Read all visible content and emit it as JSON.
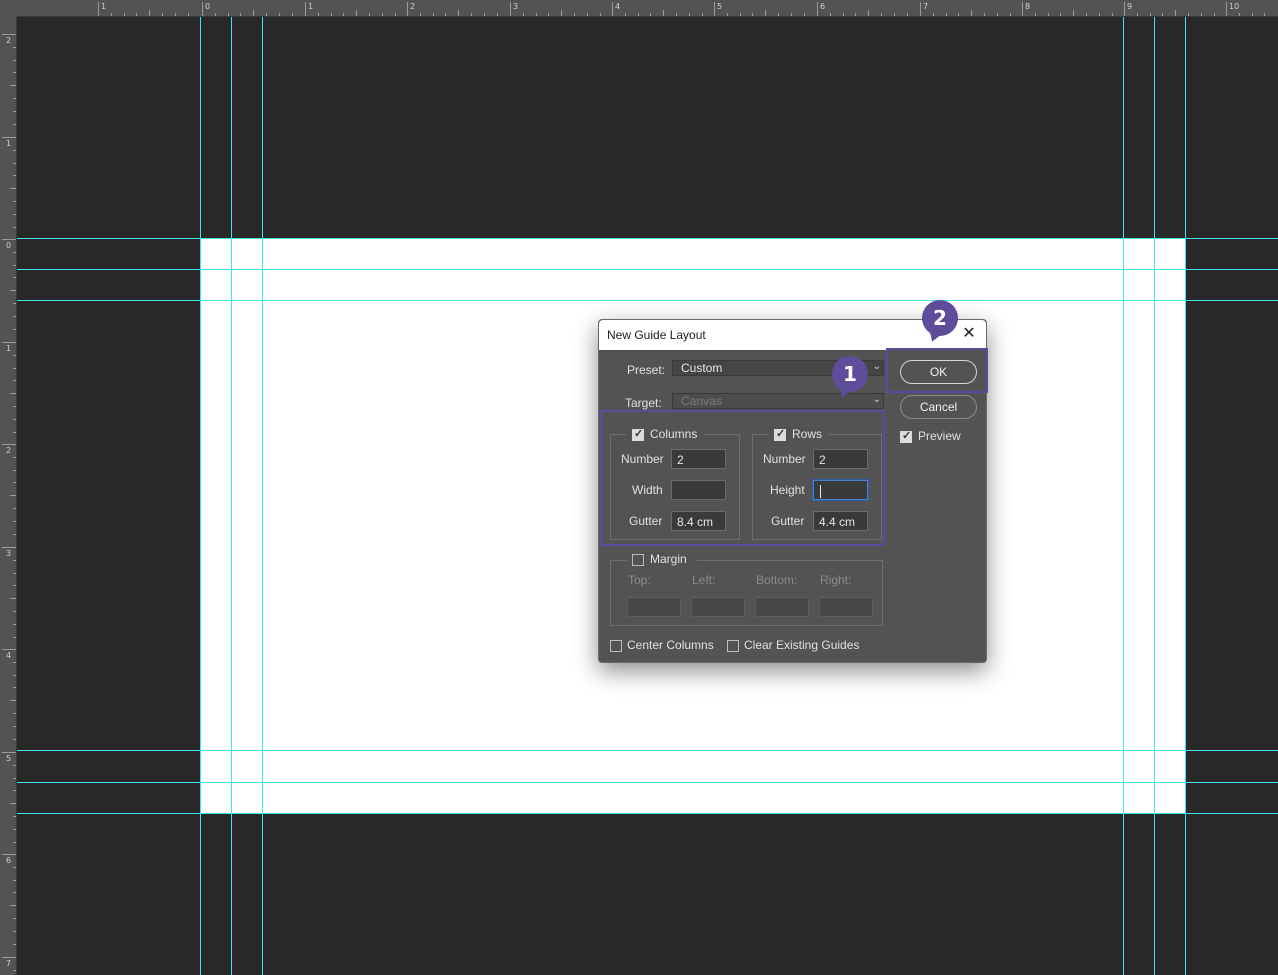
{
  "rulers": {
    "top_labels": [
      "1",
      "0",
      "1",
      "2",
      "3",
      "4",
      "5",
      "6",
      "7",
      "8",
      "9",
      "10"
    ],
    "left_labels": [
      "2",
      "1",
      "0",
      "1",
      "2",
      "3",
      "4",
      "5",
      "6",
      "7"
    ]
  },
  "dialog": {
    "title": "New Guide Layout",
    "preset_label": "Preset:",
    "preset_value": "Custom",
    "target_label": "Target:",
    "target_value": "Canvas",
    "columns": {
      "label": "Columns",
      "checked": true,
      "number_label": "Number",
      "number_value": "2",
      "width_label": "Width",
      "width_value": "",
      "gutter_label": "Gutter",
      "gutter_value": "8.4 cm"
    },
    "rows": {
      "label": "Rows",
      "checked": true,
      "number_label": "Number",
      "number_value": "2",
      "height_label": "Height",
      "height_value": "",
      "gutter_label": "Gutter",
      "gutter_value": "4.4 cm"
    },
    "margin": {
      "label": "Margin",
      "checked": false,
      "top_label": "Top:",
      "left_label": "Left:",
      "bottom_label": "Bottom:",
      "right_label": "Right:"
    },
    "center_columns_label": "Center Columns",
    "clear_guides_label": "Clear Existing Guides",
    "ok_label": "OK",
    "cancel_label": "Cancel",
    "preview_label": "Preview",
    "preview_checked": true
  },
  "annotations": {
    "badge1": "1",
    "badge2": "2",
    "accent_color": "#5e4d9b"
  },
  "guide_color": "#3ee6ea"
}
